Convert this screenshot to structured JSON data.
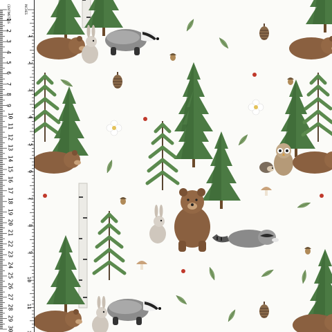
{
  "ruler": {
    "unit_label_cm": "CENTIMETERS",
    "unit_label_in": "INCHES",
    "cm_numbers": [
      "1",
      "2",
      "3",
      "4",
      "5",
      "6",
      "7",
      "8",
      "9",
      "10",
      "11",
      "12",
      "13",
      "14",
      "15",
      "16",
      "17",
      "18",
      "19",
      "20",
      "21",
      "22",
      "23",
      "24",
      "25",
      "26",
      "27",
      "28",
      "29",
      "30"
    ],
    "inch_numbers": [
      "1",
      "2",
      "3",
      "4",
      "5",
      "6",
      "7",
      "8",
      "9",
      "10",
      "11",
      "12"
    ]
  },
  "colors": {
    "background": "#fbfbf8",
    "tree_dark": "#3f6b3a",
    "tree_light": "#6f9a5c",
    "bear_brown": "#8a6040",
    "badger_grey": "#6f6f6f",
    "berry_red": "#c0392b"
  },
  "motifs": [
    "pine-tree",
    "birch-tree",
    "brown-bear",
    "badger",
    "rabbit",
    "raccoon",
    "owl",
    "hedgehog",
    "pinecone",
    "mushroom",
    "acorn",
    "flower",
    "leaf",
    "berry"
  ]
}
